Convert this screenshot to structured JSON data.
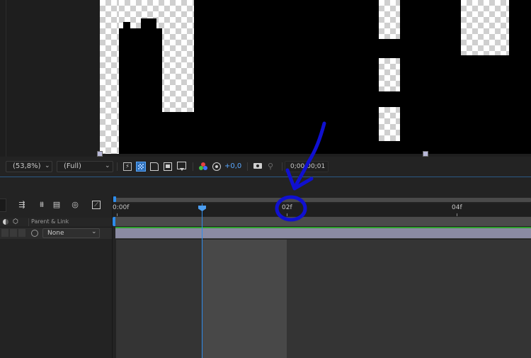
{
  "viewer_toolbar": {
    "zoom": "(53,8%)",
    "resolution": "(Full)",
    "exposure": "+0,0",
    "timecode": "0;00;00;01"
  },
  "timeline": {
    "ruler_labels": [
      "0:00f",
      "02f",
      "04f"
    ],
    "column_parent_link": "Parent & Link",
    "parent_value": "None"
  },
  "icons": {
    "fast_previews": "lightning-icon",
    "transparency_grid": "grid-icon",
    "mask_visibility": "mask-icon",
    "region_of_interest": "roi-icon",
    "channels": "color-channel-icon",
    "reset_exposure": "reset-exposure-icon",
    "snapshot": "camera-icon",
    "show_snapshot": "show-snapshot-icon"
  },
  "colors": {
    "panel": "#232323",
    "accent_blue": "#2d8ceb",
    "annotation": "#1010d0",
    "layer_bar": "#8b8ba3",
    "work_area_green": "#2ea02e"
  }
}
